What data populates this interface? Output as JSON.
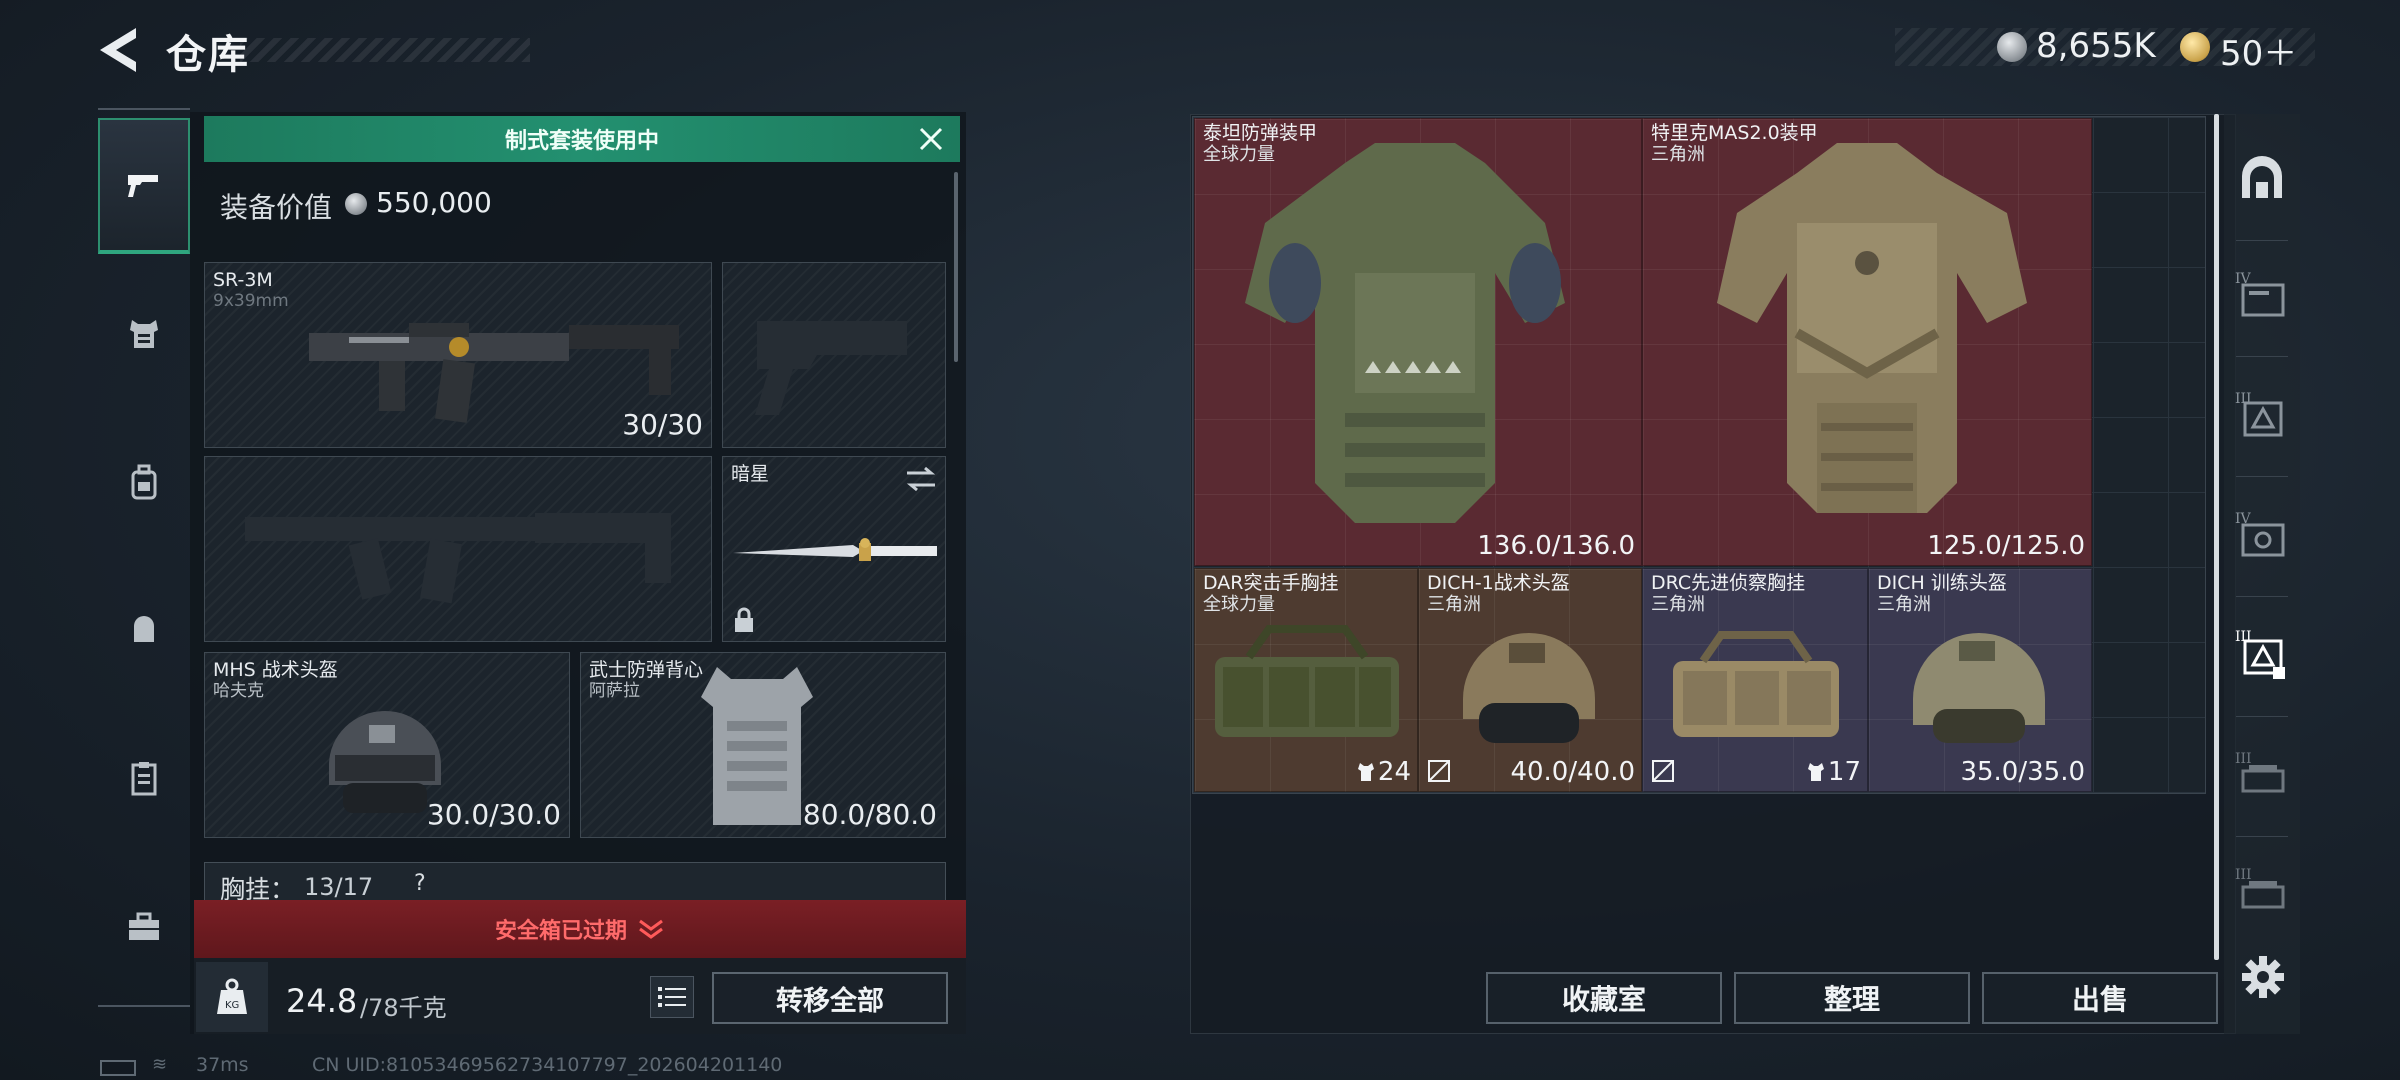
{
  "header": {
    "title": "仓库",
    "currency": {
      "silver_value": "8,655K",
      "gold_value": "50＋"
    }
  },
  "loadout": {
    "preset_banner": "制式套装使用中",
    "equip_value_label": "装备价值",
    "equip_value": "550,000",
    "primary_weapon": {
      "name": "SR-3M",
      "caliber": "9x39mm",
      "ammo": "30/30"
    },
    "melee": {
      "name": "暗星"
    },
    "helmet": {
      "name": "MHS 战术头盔",
      "map": "哈夫克",
      "durability": "30.0/30.0"
    },
    "armor": {
      "name": "武士防弹背心",
      "map": "阿萨拉",
      "durability": "80.0/80.0"
    },
    "chest_rig_label": "胸挂：",
    "chest_rig_value": "13/17",
    "chest_rig_help": "?",
    "safe_box_status": "安全箱已过期",
    "weight_current": "24.8",
    "weight_max": "/78千克",
    "transfer_all": "转移全部"
  },
  "status": {
    "ping": "37ms",
    "uid": "CN UID:81053469562734107797_202604201140"
  },
  "storage": {
    "items": [
      {
        "name": "泰坦防弹装甲",
        "map": "全球力量",
        "durability": "136.0/136.0",
        "rarity_color": "#5a2a32"
      },
      {
        "name": "特里克MAS2.0装甲",
        "map": "三角洲",
        "durability": "125.0/125.0",
        "rarity_color": "#5a2a32"
      },
      {
        "name": "DAR突击手胸挂",
        "map": "全球力量",
        "count": "24",
        "rarity_color": "#4e3b30"
      },
      {
        "name": "DICH-1战术头盔",
        "map": "三角洲",
        "durability": "40.0/40.0",
        "rarity_color": "#4e3b30"
      },
      {
        "name": "DRC先进侦察胸挂",
        "map": "三角洲",
        "count": "17",
        "rarity_color": "#3a3950"
      },
      {
        "name": "DICH 训练头盔",
        "map": "三角洲",
        "durability": "35.0/35.0",
        "rarity_color": "#3a3950"
      }
    ],
    "buttons": {
      "collection": "收藏室",
      "organize": "整理",
      "sell": "出售"
    }
  },
  "left_rail": [
    "pistol-icon",
    "armor-icon",
    "backpack-icon",
    "bag-icon",
    "clipboard-icon",
    "toolbox-icon"
  ],
  "right_rail": [
    "shelter-icon",
    "tier-iv-folder-icon",
    "tier-iii-box-icon",
    "tier-iv-folder-icon",
    "tier-iii-box-icon",
    "tier-iii-tray-icon",
    "tier-iii-tray-icon"
  ]
}
